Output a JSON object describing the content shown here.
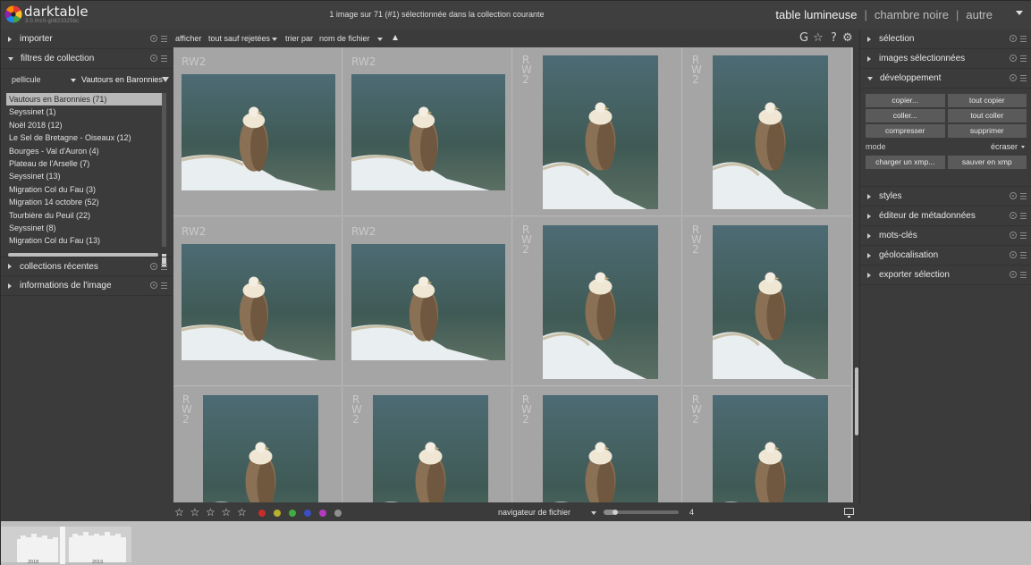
{
  "app": {
    "name": "darktable",
    "version": "3.0.0rc0-git823325bc",
    "status": "1 image sur 71 (#1) sélectionnée dans la collection courante",
    "views": [
      "table lumineuse",
      "chambre noire",
      "autre"
    ],
    "view_separator": "|",
    "active_view": "table lumineuse"
  },
  "left_panel": {
    "modules": {
      "import": "importer",
      "collect": "filtres de collection",
      "recent": "collections récentes",
      "image_info": "informations de l'image"
    },
    "collect": {
      "property": "pellicule",
      "value": "Vautours en Baronnies",
      "films": [
        "Vautours en Baronnies (71)",
        "Seyssinet (1)",
        "Noël 2018 (12)",
        "Le Sel de Bretagne - Oiseaux (12)",
        "Bourges - Val d'Auron (4)",
        "Plateau de l'Arselle (7)",
        "Seyssinet (13)",
        "Migration Col du Fau (3)",
        "Migration 14 octobre (52)",
        "Tourbière du Peuil (22)",
        "Seyssinet (8)",
        "Migration Col du Fau (13)"
      ]
    }
  },
  "center": {
    "toolbar": {
      "show_label": "afficher",
      "show_value": "tout sauf rejetées",
      "sort_label": "trier par",
      "sort_value": "nom de fichier",
      "icons": [
        "grouping-icon",
        "star-overlay-icon",
        "help-icon",
        "preferences-icon"
      ],
      "grouping_glyph": "G",
      "overlay_glyph": "☆",
      "help_glyph": "?",
      "prefs_glyph": "⚙"
    },
    "thumbnails": [
      {
        "ext": "RW2",
        "orientation": "landscape"
      },
      {
        "ext": "RW2",
        "orientation": "landscape"
      },
      {
        "ext": "RW2",
        "orientation": "portrait"
      },
      {
        "ext": "RW2",
        "orientation": "portrait"
      },
      {
        "ext": "RW2",
        "orientation": "landscape"
      },
      {
        "ext": "RW2",
        "orientation": "landscape"
      },
      {
        "ext": "RW2",
        "orientation": "portrait"
      },
      {
        "ext": "RW2",
        "orientation": "portrait"
      },
      {
        "ext": "RW2",
        "orientation": "portrait"
      },
      {
        "ext": "RW2",
        "orientation": "portrait"
      },
      {
        "ext": "RW2",
        "orientation": "portrait"
      },
      {
        "ext": "RW2",
        "orientation": "portrait"
      }
    ],
    "bottom": {
      "star_glyph": "☆",
      "star_count": 5,
      "color_labels": [
        "#c62e2e",
        "#b8b030",
        "#3fae3f",
        "#3b4fc4",
        "#b43bc0",
        "#8f8f8f"
      ],
      "navigator_label": "navigateur de fichier",
      "zoom_value": "4",
      "zoom_fraction": 0.15
    }
  },
  "right_panel": {
    "modules": {
      "select": "sélection",
      "selected_images": "images sélectionnées",
      "history": "développement",
      "styles": "styles",
      "metadata": "éditeur de métadonnées",
      "tagging": "mots-clés",
      "geotagging": "géolocalisation",
      "export": "exporter sélection"
    },
    "history": {
      "copy": "copier...",
      "copy_all": "tout copier",
      "paste": "coller...",
      "paste_all": "tout coller",
      "compress": "compresser",
      "discard": "supprimer",
      "mode_label": "mode",
      "mode_value": "écraser",
      "load_xmp": "charger un xmp...",
      "save_xmp": "sauver en xmp"
    }
  },
  "timeline": {
    "years": [
      "2018",
      "2019"
    ]
  }
}
